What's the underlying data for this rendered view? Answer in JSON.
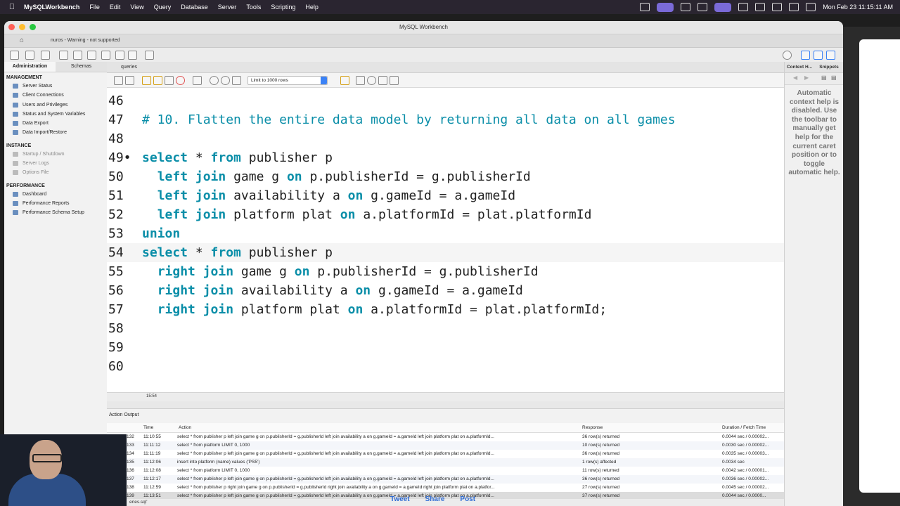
{
  "menubar": {
    "app_name": "MySQLWorkbench",
    "items": [
      "File",
      "Edit",
      "View",
      "Query",
      "Database",
      "Server",
      "Tools",
      "Scripting",
      "Help"
    ],
    "clock": "Mon Feb 23  11:15:11 AM"
  },
  "window": {
    "title": "MySQL Workbench",
    "connection_tab": "nuros - Warning - not supported"
  },
  "sidebar": {
    "tabs": [
      "Administration",
      "Schemas"
    ],
    "management_title": "MANAGEMENT",
    "management": [
      "Server Status",
      "Client Connections",
      "Users and Privileges",
      "Status and System Variables",
      "Data Export",
      "Data Import/Restore"
    ],
    "instance_title": "INSTANCE",
    "instance": [
      "Startup / Shutdown",
      "Server Logs",
      "Options File"
    ],
    "performance_title": "PERFORMANCE",
    "performance": [
      "Dashboard",
      "Performance Reports",
      "Performance Schema Setup"
    ]
  },
  "editor": {
    "tab_label": "queries",
    "limit_select": "Limit to 1000 rows",
    "cursor_position": "15:54",
    "lines": [
      {
        "n": "46",
        "segs": []
      },
      {
        "n": "47",
        "segs": [
          {
            "t": "# 10. Flatten the entire data model by returning all data on all games",
            "c": "cm"
          }
        ]
      },
      {
        "n": "48",
        "segs": []
      },
      {
        "n": "49•",
        "segs": [
          {
            "t": "select",
            "c": "kw"
          },
          {
            "t": " * ",
            "c": ""
          },
          {
            "t": "from",
            "c": "kw"
          },
          {
            "t": " publisher p",
            "c": ""
          }
        ]
      },
      {
        "n": "50",
        "segs": [
          {
            "t": "  ",
            "c": ""
          },
          {
            "t": "left join",
            "c": "kw"
          },
          {
            "t": " game g ",
            "c": ""
          },
          {
            "t": "on",
            "c": "kw"
          },
          {
            "t": " p.publisherId = g.publisherId",
            "c": ""
          }
        ]
      },
      {
        "n": "51",
        "segs": [
          {
            "t": "  ",
            "c": ""
          },
          {
            "t": "left join",
            "c": "kw"
          },
          {
            "t": " availability a ",
            "c": ""
          },
          {
            "t": "on",
            "c": "kw"
          },
          {
            "t": " g.gameId = a.gameId",
            "c": ""
          }
        ]
      },
      {
        "n": "52",
        "segs": [
          {
            "t": "  ",
            "c": ""
          },
          {
            "t": "left join",
            "c": "kw"
          },
          {
            "t": " platform plat ",
            "c": ""
          },
          {
            "t": "on",
            "c": "kw"
          },
          {
            "t": " a.platformId = plat.platformId",
            "c": ""
          }
        ]
      },
      {
        "n": "53",
        "segs": [
          {
            "t": "union",
            "c": "kw"
          }
        ]
      },
      {
        "n": "54",
        "segs": [
          {
            "t": "select",
            "c": "kw"
          },
          {
            "t": " * ",
            "c": ""
          },
          {
            "t": "from",
            "c": "kw"
          },
          {
            "t": " publisher p",
            "c": ""
          }
        ],
        "current": true
      },
      {
        "n": "55",
        "segs": [
          {
            "t": "  ",
            "c": ""
          },
          {
            "t": "right join",
            "c": "kw"
          },
          {
            "t": " game g ",
            "c": ""
          },
          {
            "t": "on",
            "c": "kw"
          },
          {
            "t": " p.publisherId = g.publisherId",
            "c": ""
          }
        ]
      },
      {
        "n": "56",
        "segs": [
          {
            "t": "  ",
            "c": ""
          },
          {
            "t": "right join",
            "c": "kw"
          },
          {
            "t": " availability a ",
            "c": ""
          },
          {
            "t": "on",
            "c": "kw"
          },
          {
            "t": " g.gameId = a.gameId",
            "c": ""
          }
        ]
      },
      {
        "n": "57",
        "segs": [
          {
            "t": "  ",
            "c": ""
          },
          {
            "t": "right join",
            "c": "kw"
          },
          {
            "t": " platform plat ",
            "c": ""
          },
          {
            "t": "on",
            "c": "kw"
          },
          {
            "t": " a.platformId = plat.platformId;",
            "c": ""
          }
        ]
      },
      {
        "n": "58",
        "segs": []
      },
      {
        "n": "59",
        "segs": []
      },
      {
        "n": "60",
        "segs": []
      }
    ]
  },
  "output": {
    "selector": "Action Output",
    "columns": [
      "Time",
      "Action",
      "Response",
      "Duration / Fetch Time"
    ],
    "rows": [
      {
        "num": "132",
        "time": "11:10:55",
        "action": "select * from publisher p   left join game g on p.publisherId = g.publisherId   left join availability a on g.gameId = a.gameId   left join platform plat on a.platformId...",
        "response": "36 row(s) returned",
        "duration": "0.0044 sec / 0.00002...",
        "ok": true
      },
      {
        "num": "133",
        "time": "11:11:12",
        "action": "select * from platform LIMIT 0, 1000",
        "response": "10 row(s) returned",
        "duration": "0.0030 sec / 0.00002...",
        "ok": true
      },
      {
        "num": "134",
        "time": "11:11:19",
        "action": "select * from publisher p   left join game g on p.publisherId = g.publisherId   left join availability a on g.gameId = a.gameId   left join platform plat on a.platformId...",
        "response": "36 row(s) returned",
        "duration": "0.0035 sec / 0.00003...",
        "ok": true
      },
      {
        "num": "135",
        "time": "11:12:06",
        "action": "insert into platform (name) values ('PS5')",
        "response": "1 row(s) affected",
        "duration": "0.0034 sec",
        "ok": false
      },
      {
        "num": "136",
        "time": "11:12:08",
        "action": "select * from platform LIMIT 0, 1000",
        "response": "11 row(s) returned",
        "duration": "0.0042 sec / 0.00001...",
        "ok": false
      },
      {
        "num": "137",
        "time": "11:12:17",
        "action": "select * from publisher p   left join game g on p.publisherId = g.publisherId   left join availability a on g.gameId = a.gameId   left join platform plat on a.platformId...",
        "response": "36 row(s) returned",
        "duration": "0.0036 sec / 0.00002...",
        "ok": false
      },
      {
        "num": "138",
        "time": "11:12:59",
        "action": "select * from publisher p   right join game g on p.publisherId = g.publisherId   right join availability a on g.gameId = a.gameId   right join platform plat on a.platfor...",
        "response": "27 row(s) returned",
        "duration": "0.0045 sec / 0.00002...",
        "ok": false
      },
      {
        "num": "139",
        "time": "11:13:51",
        "action": "select * from publisher p   left join game g on p.publisherId = g.publisherId   left join availability a on g.gameId = a.gameId   left join platform plat on a.platformId...",
        "response": "37 row(s) returned",
        "duration": "0.0044 sec / 0.0000...",
        "ok": false
      }
    ]
  },
  "bottom": {
    "file": "eries.sql'"
  },
  "right_panel": {
    "tabs": [
      "Context H...",
      "Snippets"
    ],
    "help_text": "Automatic context help is disabled. Use the toolbar to manually get help for the current caret position or to toggle automatic help."
  },
  "share": {
    "tweet": "Tweet",
    "share": "Share",
    "post": "Post"
  },
  "colors": {
    "keyword": "#0a8ea8",
    "ok_status": "#2ea44f",
    "menubar_bg": "#2a2530"
  }
}
